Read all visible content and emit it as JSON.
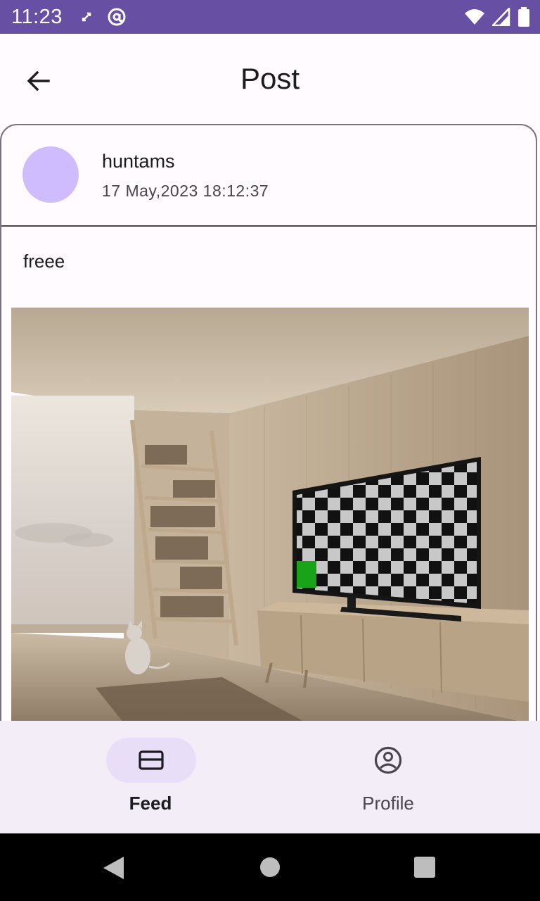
{
  "status_bar": {
    "time": "11:23",
    "icons": [
      "sync-disabled-icon",
      "at-sign-icon",
      "wifi-icon",
      "signal-icon",
      "battery-icon"
    ],
    "background_color": "#6750a4"
  },
  "app_bar": {
    "title": "Post",
    "back_icon": "arrow-back-icon"
  },
  "post": {
    "username": "huntams",
    "timestamp": "17 May,2023 18:12:37",
    "text": "freee",
    "avatar_color": "#cfbcff",
    "image_description": "room-photo"
  },
  "bottom_nav": {
    "items": [
      {
        "label": "Feed",
        "icon": "feed-card-icon",
        "selected": true
      },
      {
        "label": "Profile",
        "icon": "account-circle-icon",
        "selected": false
      }
    ],
    "background_color": "#f3edf7",
    "indicator_color": "#e8def8"
  },
  "system_nav": {
    "icons": [
      "back-triangle-icon",
      "home-circle-icon",
      "recents-square-icon"
    ]
  }
}
